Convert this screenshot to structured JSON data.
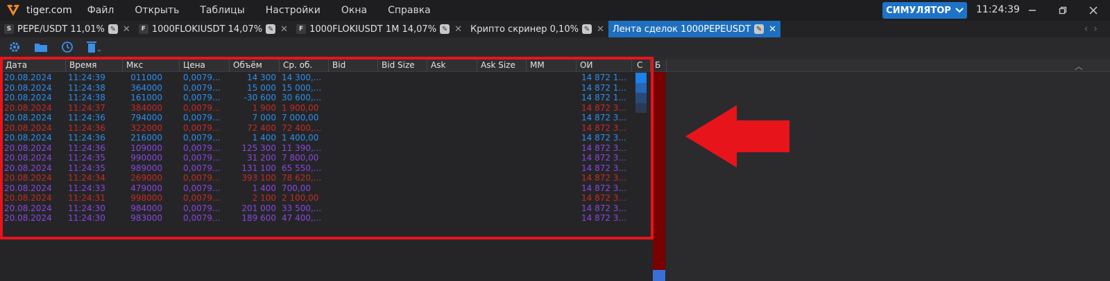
{
  "app": {
    "brand": "tiger.com",
    "menu": [
      "Файл",
      "Открыть",
      "Таблицы",
      "Настройки",
      "Окна",
      "Справка"
    ],
    "mode_button": "СИМУЛЯТОР",
    "clock": "11:24:39"
  },
  "tabs": [
    {
      "type": "S",
      "label": "PEPE/USDT 11,01%",
      "active": false
    },
    {
      "type": "F",
      "label": "1000FLOKIUSDT 14,07%",
      "active": false
    },
    {
      "type": "F",
      "label": "1000FLOKIUSDT 1M 14,07%",
      "active": false
    },
    {
      "type": "",
      "label": "Крипто скринер 0,10%",
      "active": false
    },
    {
      "type": "",
      "label": "Лента сделок 1000PEPEUSDT",
      "active": true
    }
  ],
  "table": {
    "columns": [
      "Дата",
      "Время",
      "Мкс",
      "Цена",
      "Объём",
      "Ср. об.",
      "Bid",
      "Bid Size",
      "Ask",
      "Ask Size",
      "MM",
      "ОИ",
      "С",
      "Б"
    ],
    "rows": [
      {
        "color": "blue",
        "date": "20.08.2024",
        "time": "11:24:39",
        "mks": "011000",
        "price": "0,0079...",
        "vol": "14 300",
        "avg": "14 300,...",
        "oi": "14 872 1..."
      },
      {
        "color": "blue",
        "date": "20.08.2024",
        "time": "11:24:38",
        "mks": "364000",
        "price": "0,0079...",
        "vol": "15 000",
        "avg": "15 000,...",
        "oi": "14 872 1..."
      },
      {
        "color": "blue",
        "date": "20.08.2024",
        "time": "11:24:38",
        "mks": "161000",
        "price": "0,0079...",
        "vol": "-30 600",
        "avg": "30 600,...",
        "oi": "14 872 1..."
      },
      {
        "color": "red",
        "date": "20.08.2024",
        "time": "11:24:37",
        "mks": "384000",
        "price": "0,0079...",
        "vol": "1 900",
        "avg": "1 900,00",
        "oi": "14 872 3..."
      },
      {
        "color": "blue",
        "date": "20.08.2024",
        "time": "11:24:36",
        "mks": "794000",
        "price": "0,0079...",
        "vol": "7 000",
        "avg": "7 000,00",
        "oi": "14 872 3..."
      },
      {
        "color": "red",
        "date": "20.08.2024",
        "time": "11:24:36",
        "mks": "322000",
        "price": "0,0079...",
        "vol": "72 400",
        "avg": "72 400,...",
        "oi": "14 872 3..."
      },
      {
        "color": "blue",
        "date": "20.08.2024",
        "time": "11:24:36",
        "mks": "216000",
        "price": "0,0079...",
        "vol": "1 400",
        "avg": "1 400,00",
        "oi": "14 872 3..."
      },
      {
        "color": "purple",
        "date": "20.08.2024",
        "time": "11:24:36",
        "mks": "109000",
        "price": "0,0079...",
        "vol": "125 300",
        "avg": "11 390,...",
        "oi": "14 872 3..."
      },
      {
        "color": "purple",
        "date": "20.08.2024",
        "time": "11:24:35",
        "mks": "990000",
        "price": "0,0079...",
        "vol": "31 200",
        "avg": "7 800,00",
        "oi": "14 872 3..."
      },
      {
        "color": "purple",
        "date": "20.08.2024",
        "time": "11:24:35",
        "mks": "989000",
        "price": "0,0079...",
        "vol": "131 100",
        "avg": "65 550,...",
        "oi": "14 872 3..."
      },
      {
        "color": "red",
        "date": "20.08.2024",
        "time": "11:24:34",
        "mks": "269000",
        "price": "0,0079...",
        "vol": "393 100",
        "avg": "78 620,...",
        "oi": "14 872 3..."
      },
      {
        "color": "purple",
        "date": "20.08.2024",
        "time": "11:24:33",
        "mks": "479000",
        "price": "0,0079...",
        "vol": "1 400",
        "avg": "700,00",
        "oi": "14 872 3..."
      },
      {
        "color": "red",
        "date": "20.08.2024",
        "time": "11:24:31",
        "mks": "998000",
        "price": "0,0079...",
        "vol": "2 100",
        "avg": "2 100,00",
        "oi": "14 872 3..."
      },
      {
        "color": "purple",
        "date": "20.08.2024",
        "time": "11:24:30",
        "mks": "984000",
        "price": "0,0079...",
        "vol": "201 000",
        "avg": "33 500,...",
        "oi": "14 872 3..."
      },
      {
        "color": "purple",
        "date": "20.08.2024",
        "time": "11:24:30",
        "mks": "983000",
        "price": "0,0079...",
        "vol": "189 600",
        "avg": "47 400,...",
        "oi": "14 872 3..."
      }
    ]
  },
  "colors": {
    "blue": "#2e8ef0",
    "red": "#c72a26",
    "purple": "#8a46e0",
    "accent": "#1e6fbf",
    "annotation": "#e8141c"
  },
  "icons": {
    "toolbar": [
      "gear-icon",
      "folder-icon",
      "clock-icon",
      "trash-icon"
    ],
    "window": [
      "minimize-icon",
      "maximize-icon",
      "close-icon"
    ]
  }
}
